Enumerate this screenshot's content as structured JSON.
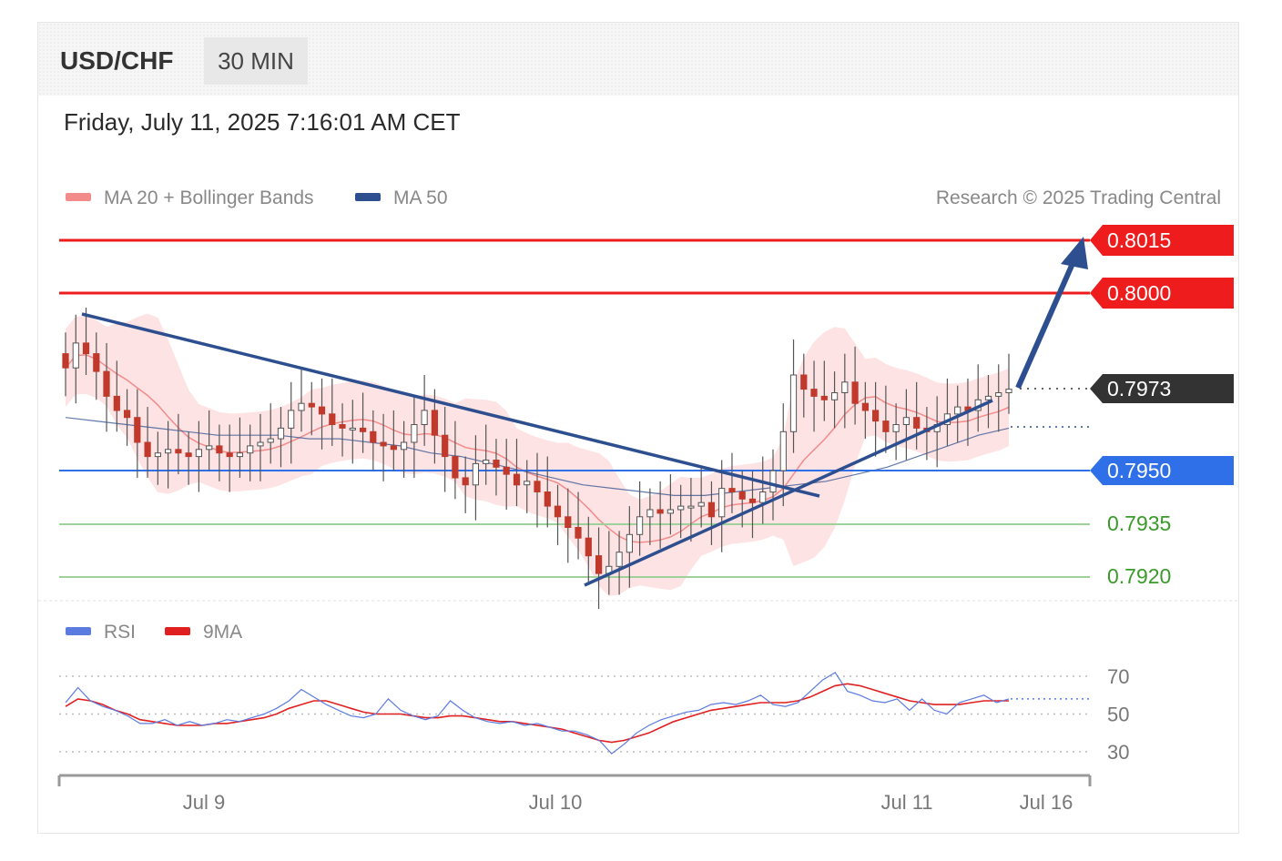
{
  "header": {
    "symbol": "USD/CHF",
    "timeframe": "30 MIN",
    "datetime": "Friday, July 11, 2025 7:16:01 AM CET"
  },
  "legend": {
    "items": [
      {
        "label": "MA 20 + Bollinger Bands",
        "color": "#f48b8b"
      },
      {
        "label": "MA 50",
        "color": "#2d4f8f"
      }
    ],
    "credit": "Research © 2025 Trading Central"
  },
  "rsi_legend": {
    "items": [
      {
        "label": "RSI",
        "color": "#5b7be0"
      },
      {
        "label": "9MA",
        "color": "#e02020"
      }
    ]
  },
  "colors": {
    "resistance": "#ee1c1c",
    "current": "#333333",
    "pivot": "#2f6fe8",
    "support": "#3a9a2a",
    "trendline": "#2d4f8f",
    "bollinger_fill": "#fde3e3",
    "ma20": "#f48b8b",
    "ma50": "#2d4f8f",
    "candle": "#c0392b"
  },
  "chart_data": [
    {
      "type": "candlestick",
      "title": "USD/CHF",
      "timeframe": "30 MIN",
      "x_tick_labels": [
        "Jul 9",
        "Jul 10",
        "Jul 11",
        "Jul 16"
      ],
      "ylim": [
        0.7918,
        0.8022
      ],
      "last_price": {
        "label": "0.7973",
        "value": 0.7973
      },
      "resistance_levels": [
        {
          "label": "0.8015",
          "value": 0.8015
        },
        {
          "label": "0.8000",
          "value": 0.8
        }
      ],
      "pivot_level": {
        "label": "0.7950",
        "value": 0.795
      },
      "support_levels": [
        {
          "label": "0.7935",
          "value": 0.7935
        },
        {
          "label": "0.7920",
          "value": 0.792
        }
      ],
      "candle_closes": [
        0.7979,
        0.7986,
        0.7983,
        0.7978,
        0.7971,
        0.7967,
        0.7965,
        0.7958,
        0.7954,
        0.7955,
        0.7956,
        0.7955,
        0.7954,
        0.7956,
        0.7957,
        0.7955,
        0.7954,
        0.7955,
        0.7957,
        0.7958,
        0.7959,
        0.7962,
        0.7967,
        0.7969,
        0.7968,
        0.7966,
        0.7963,
        0.7962,
        0.7962,
        0.7961,
        0.7958,
        0.7957,
        0.7956,
        0.7958,
        0.7963,
        0.7967,
        0.796,
        0.7954,
        0.7948,
        0.7946,
        0.7952,
        0.7953,
        0.7951,
        0.7949,
        0.7946,
        0.7947,
        0.7944,
        0.794,
        0.7937,
        0.7934,
        0.7931,
        0.7926,
        0.7921,
        0.7923,
        0.7927,
        0.7932,
        0.7937,
        0.7939,
        0.7938,
        0.7939,
        0.794,
        0.794,
        0.7941,
        0.7937,
        0.7945,
        0.7944,
        0.7942,
        0.7941,
        0.7944,
        0.795,
        0.7961,
        0.7977,
        0.7973,
        0.7971,
        0.797,
        0.7972,
        0.7975,
        0.7969,
        0.7967,
        0.7964,
        0.7961,
        0.7963,
        0.7965,
        0.7962,
        0.7961,
        0.7963,
        0.7966,
        0.7968,
        0.7967,
        0.797,
        0.7971,
        0.7972,
        0.7973
      ],
      "ma50_values": [
        0.7965,
        0.7964,
        0.7963,
        0.7962,
        0.7961,
        0.796,
        0.796,
        0.796,
        0.7959,
        0.7959,
        0.7958,
        0.7957,
        0.7955,
        0.7954,
        0.7952,
        0.795,
        0.7948,
        0.7946,
        0.7945,
        0.7944,
        0.7943,
        0.7943,
        0.7944,
        0.7945,
        0.7946,
        0.7947,
        0.7949,
        0.7951,
        0.7954,
        0.7957,
        0.796,
        0.7962
      ],
      "rsi": {
        "ylim": [
          20,
          80
        ],
        "levels": [
          30,
          50,
          70
        ],
        "level_labels": [
          "70",
          "50",
          "30"
        ],
        "rsi_values": [
          56,
          64,
          57,
          54,
          52,
          49,
          45,
          45,
          47,
          44,
          46,
          44,
          45,
          47,
          46,
          48,
          50,
          53,
          57,
          63,
          59,
          55,
          52,
          49,
          48,
          50,
          58,
          52,
          49,
          47,
          49,
          57,
          52,
          48,
          46,
          45,
          46,
          44,
          45,
          43,
          41,
          41,
          39,
          36,
          29,
          34,
          40,
          44,
          47,
          49,
          51,
          52,
          55,
          56,
          55,
          57,
          60,
          55,
          54,
          56,
          62,
          68,
          72,
          62,
          60,
          57,
          56,
          58,
          52,
          58,
          52,
          50,
          56,
          58,
          60,
          56,
          58
        ],
        "ma_values": [
          54,
          58,
          57,
          55,
          52,
          50,
          47,
          46,
          45,
          44,
          44,
          44,
          45,
          45,
          46,
          47,
          48,
          50,
          53,
          55,
          57,
          57,
          55,
          53,
          51,
          50,
          50,
          50,
          49,
          48,
          48,
          49,
          49,
          48,
          47,
          46,
          46,
          45,
          44,
          43,
          42,
          40,
          38,
          36,
          35,
          36,
          38,
          40,
          43,
          46,
          48,
          50,
          52,
          53,
          54,
          55,
          56,
          56,
          56,
          57,
          59,
          62,
          65,
          66,
          65,
          63,
          61,
          59,
          57,
          56,
          55,
          55,
          55,
          56,
          57,
          57,
          57
        ]
      }
    }
  ]
}
